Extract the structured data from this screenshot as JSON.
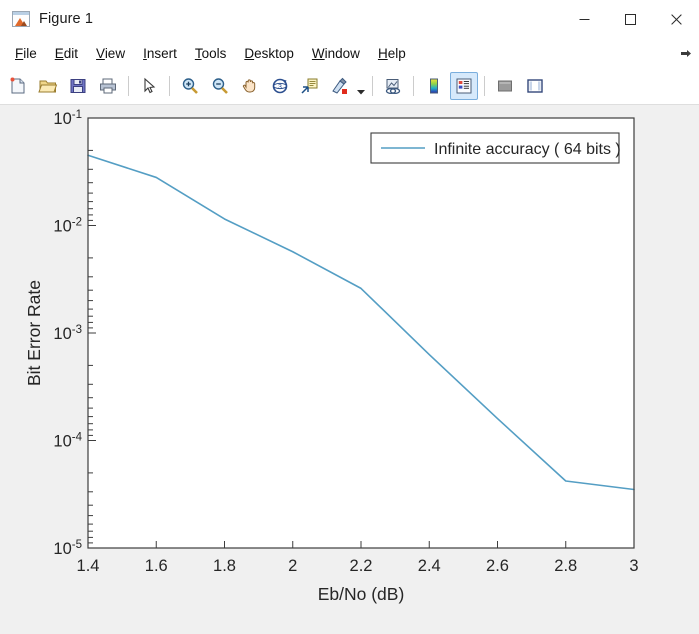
{
  "window": {
    "title": "Figure 1",
    "icon": "matlab-figure-icon",
    "controls": [
      {
        "name": "minimize-button",
        "glyph": "minimize"
      },
      {
        "name": "maximize-button",
        "glyph": "maximize"
      },
      {
        "name": "close-button",
        "glyph": "close"
      }
    ]
  },
  "menubar": {
    "items": [
      {
        "label": "File",
        "mnemonic": "F"
      },
      {
        "label": "Edit",
        "mnemonic": "E"
      },
      {
        "label": "View",
        "mnemonic": "V"
      },
      {
        "label": "Insert",
        "mnemonic": "I"
      },
      {
        "label": "Tools",
        "mnemonic": "T"
      },
      {
        "label": "Desktop",
        "mnemonic": "D"
      },
      {
        "label": "Window",
        "mnemonic": "W"
      },
      {
        "label": "Help",
        "mnemonic": "H"
      }
    ],
    "overflow_icon": "overflow-arrow-icon"
  },
  "toolbar": {
    "buttons": [
      {
        "name": "new-figure-button",
        "icon": "new-document-icon",
        "active": false
      },
      {
        "name": "open-file-button",
        "icon": "open-folder-icon",
        "active": false
      },
      {
        "name": "save-figure-button",
        "icon": "floppy-disk-save-icon",
        "active": false
      },
      {
        "name": "print-figure-button",
        "icon": "printer-icon",
        "active": false
      },
      {
        "name": "edit-plot-button",
        "icon": "arrow-pointer-icon",
        "active": false
      },
      {
        "name": "zoom-in-button",
        "icon": "magnifier-plus-icon",
        "active": false
      },
      {
        "name": "zoom-out-button",
        "icon": "magnifier-minus-icon",
        "active": false
      },
      {
        "name": "pan-button",
        "icon": "hand-pan-icon",
        "active": false
      },
      {
        "name": "rotate-3d-button",
        "icon": "rotate-3d-icon",
        "active": false
      },
      {
        "name": "data-cursor-button",
        "icon": "data-cursor-icon",
        "active": false
      },
      {
        "name": "brush-select-button",
        "icon": "paintbrush-icon",
        "active": false
      },
      {
        "name": "brush-dropdown-button",
        "icon": "chevron-down-icon",
        "active": false
      },
      {
        "name": "link-plot-button",
        "icon": "link-plot-icon",
        "active": false
      },
      {
        "name": "colorbar-button",
        "icon": "colorbar-icon",
        "active": false
      },
      {
        "name": "legend-button",
        "icon": "legend-icon",
        "active": true
      },
      {
        "name": "hide-plot-tools-button",
        "icon": "hide-plot-tools-icon",
        "active": false
      },
      {
        "name": "show-plot-tools-button",
        "icon": "show-plot-tools-icon",
        "active": false
      }
    ]
  },
  "colors": {
    "figure_background": "#f0f0f0",
    "axes_background": "#ffffff",
    "axes_border": "#3d3d3d",
    "line": "#549ec4",
    "text": "#262626"
  },
  "chart_data": {
    "type": "line",
    "title": "",
    "xlabel": "Eb/No (dB)",
    "ylabel": "Bit Error Rate",
    "xscale": "linear",
    "yscale": "log",
    "xlim": [
      1.4,
      3
    ],
    "ylim": [
      1e-05,
      0.1
    ],
    "grid": false,
    "legend_position": "top-right",
    "xticks": [
      "1.4",
      "1.6",
      "1.8",
      "2",
      "2.2",
      "2.4",
      "2.6",
      "2.8",
      "3"
    ],
    "xtick_values": [
      1.4,
      1.6,
      1.8,
      2.0,
      2.2,
      2.4,
      2.6,
      2.8,
      3.0
    ],
    "ytick_labels": [
      "10-1",
      "10-2",
      "10-3",
      "10-4",
      "10-5"
    ],
    "ytick_exponents": [
      "-1",
      "-2",
      "-3",
      "-4",
      "-5"
    ],
    "ytick_values": [
      0.1,
      0.01,
      0.001,
      0.0001,
      1e-05
    ],
    "series": [
      {
        "name": "Infinite accuracy ( 64 bits )",
        "color": "#549ec4",
        "x": [
          1.4,
          1.6,
          1.8,
          2.0,
          2.2,
          2.4,
          2.6,
          2.8,
          3.0
        ],
        "values": [
          0.045,
          0.028,
          0.0115,
          0.0057,
          0.0026,
          0.00063,
          0.00016,
          4.2e-05,
          3.5e-05
        ]
      }
    ]
  }
}
